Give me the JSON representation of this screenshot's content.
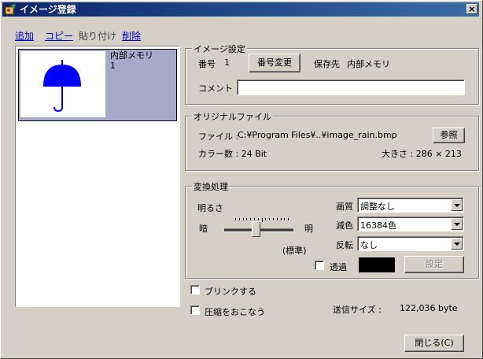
{
  "window": {
    "title": "イメージ登録",
    "close_glyph": "×"
  },
  "menu": {
    "add": "追加",
    "copy": "コピー",
    "paste": "貼り付け",
    "delete": "削除"
  },
  "list": {
    "item_name": "内部メモリ",
    "item_number": "1"
  },
  "image_settings": {
    "group_label": "イメージ設定",
    "number_label": "番号",
    "number_value": "1",
    "change_number_button": "番号変更",
    "save_dest_label": "保存先",
    "save_dest_value": "内部メモリ",
    "comment_label": "コメント",
    "comment_value": ""
  },
  "original_file": {
    "group_label": "オリジナルファイル",
    "file_label": "ファイル :",
    "file_path": "C:¥Program Files¥..¥image_rain.bmp",
    "browse_button": "参照",
    "color_count": "カラー数 : 24 Bit",
    "size": "大きさ : 286 × 213"
  },
  "conversion": {
    "group_label": "変換処理",
    "brightness_label": "明るさ",
    "dark_label": "暗",
    "bright_label": "明",
    "standard_label": "(標準)",
    "brightness_value": 0.45,
    "quality_label": "画質",
    "quality_value": "調整なし",
    "color_reduce_label": "減色",
    "color_reduce_value": "16384色",
    "flip_label": "反転",
    "flip_value": "なし",
    "transparent_label": "透過",
    "transparent_checked": false,
    "transparent_color": "#000000",
    "setting_button": "設定"
  },
  "options": {
    "blink_label": "ブリンクする",
    "blink_checked": false,
    "compress_label": "圧縮をおこなう",
    "compress_checked": false,
    "send_size_label": "送信サイズ :",
    "send_size_value": "122,036 byte"
  },
  "close_button": "閉じる(C)",
  "colors": {
    "title_bar": "#0a246a",
    "selection": "#a8a8c8",
    "umbrella": "#0000ff"
  },
  "icons": {
    "app": "image-register-icon",
    "thumbnail": "umbrella-icon"
  }
}
